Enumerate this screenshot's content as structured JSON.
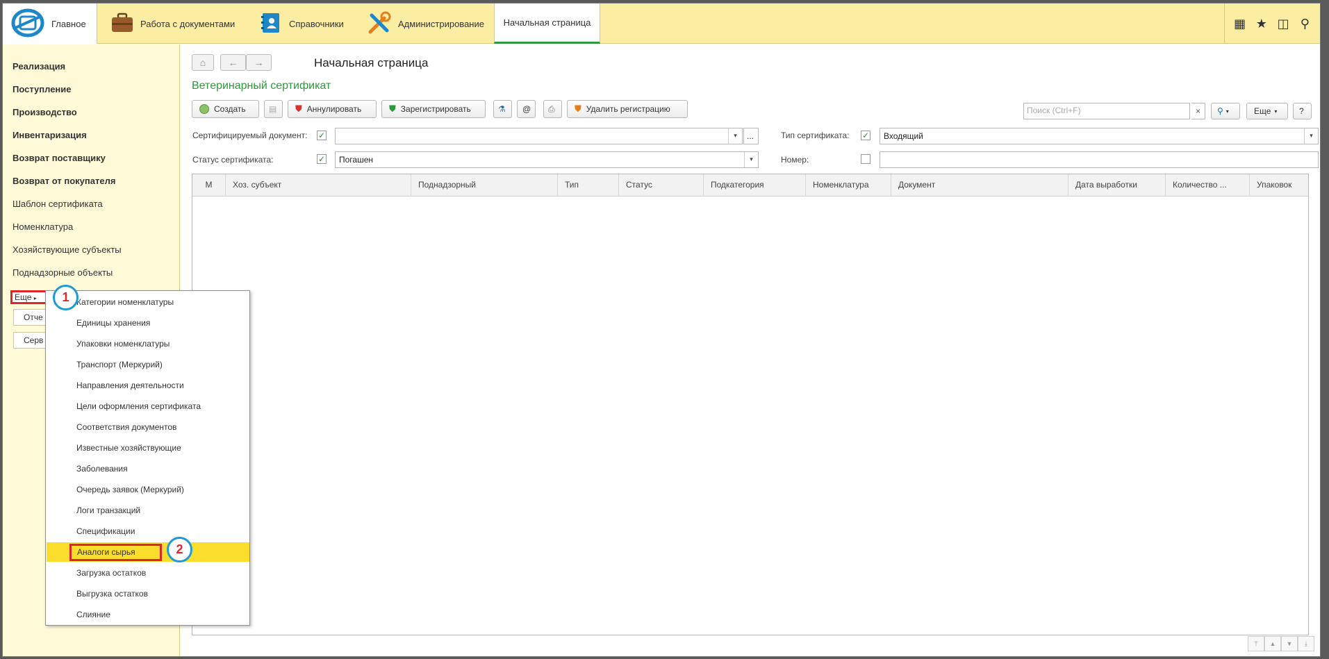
{
  "topbar": {
    "home_label": "Главное",
    "docs_label": "Работа с документами",
    "refs_label": "Справочники",
    "admin_label": "Администрирование",
    "active_tab_label": "Начальная страница",
    "icons": [
      "apps-grid-icon",
      "star-icon",
      "history-icon",
      "search-icon"
    ]
  },
  "sidebar": {
    "items": [
      {
        "label": "Реализация",
        "bold": true
      },
      {
        "label": "Поступление",
        "bold": true
      },
      {
        "label": "Производство",
        "bold": true
      },
      {
        "label": "Инвентаризация",
        "bold": true
      },
      {
        "label": "Возврат поставщику",
        "bold": true
      },
      {
        "label": "Возврат от покупателя",
        "bold": true
      },
      {
        "label": "Шаблон сертификата",
        "bold": false
      },
      {
        "label": "Номенклатура",
        "bold": false
      },
      {
        "label": "Хозяйствующие субъекты",
        "bold": false
      },
      {
        "label": "Поднадзорные объекты",
        "bold": false
      }
    ],
    "more_label": "Еще",
    "btn1_label": "Отче",
    "btn2_label": "Серв"
  },
  "main": {
    "page_title": "Начальная страница",
    "form_title": "Ветеринарный сертификат",
    "toolbar": {
      "create": "Создать",
      "annul": "Аннулировать",
      "register": "Зарегистрировать",
      "at_symbol": "@",
      "delete_reg": "Удалить регистрацию",
      "search_placeholder": "Поиск (Ctrl+F)",
      "search_clear": "×",
      "more": "Еще",
      "help": "?"
    },
    "filters": {
      "doc_label": "Сертифицируемый документ:",
      "doc_value": "",
      "doc_ellipsis": "...",
      "type_label": "Тип сертификата:",
      "type_value": "Входящий",
      "status_label": "Статус сертификата:",
      "status_value": "Погашен",
      "number_label": "Номер:",
      "number_value": ""
    },
    "columns": [
      "М",
      "Хоз. субъект",
      "Поднадзорный",
      "Тип",
      "Статус",
      "Подкатегория",
      "Номенклатура",
      "Документ",
      "Дата выработки",
      "Количество ...",
      "Упаковок"
    ]
  },
  "menu": {
    "items": [
      "Категории номенклатуры",
      "Единицы хранения",
      "Упаковки номенклатуры",
      "Транспорт (Меркурий)",
      "Направления деятельности",
      "Цели оформления сертификата",
      "Соответствия документов",
      "Известные хозяйствующие",
      "Заболевания",
      "Очередь заявок (Меркурий)",
      "Логи транзакций",
      "Спецификации",
      "Аналоги сырья",
      "Загрузка остатков",
      "Выгрузка остатков",
      "Слияние"
    ],
    "highlighted_index": 12
  },
  "annotations": {
    "badge1": "1",
    "badge2": "2"
  },
  "colors": {
    "accent_green": "#2b9a3a",
    "topbar": "#fbeea3",
    "sidebar": "#fffbd9",
    "highlight": "#fbdd2c",
    "marker_red": "#e0242c",
    "marker_blue": "#1e9ad8"
  }
}
